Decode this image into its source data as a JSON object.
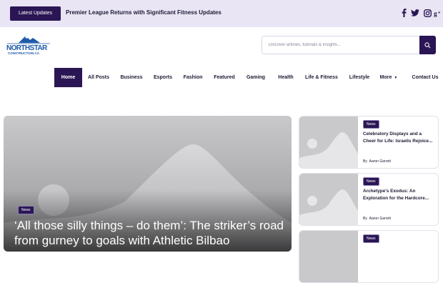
{
  "topbar": {
    "latest_label": "Latest Updates",
    "ticker_text": "Premier League Returns with Significant Fitness Updates",
    "social": [
      "facebook-icon",
      "twitter-icon",
      "instagram-icon",
      "google-plus-icon"
    ]
  },
  "logo": {
    "line1": "NORTHSTAR",
    "line2": "CONSTRUCTION.CA"
  },
  "search": {
    "placeholder": "Discover articles, tutorials & insights..."
  },
  "nav": {
    "items": [
      "Home",
      "All Posts",
      "Business",
      "Esports",
      "Fashion",
      "Featured",
      "Gaming",
      "Health",
      "Life & Fitness",
      "Lifestyle",
      "More",
      "Contact Us"
    ],
    "active": "Home"
  },
  "hero": {
    "badge": "News",
    "title": "‘All those silly things – do them’: The striker’s road from gurney to goals with Athletic Bilbao"
  },
  "cards": [
    {
      "badge": "News",
      "title": "Celebratory Displays and a Cheer for Life: Israelis Rejoice...",
      "author_prefix": "By",
      "author": "Aaron Garrett"
    },
    {
      "badge": "News",
      "title": "Archetype's Exodus: An Exploration for the Hardcore...",
      "author_prefix": "By",
      "author": "Aaron Garrett"
    },
    {
      "badge": "News",
      "title": "",
      "author_prefix": "",
      "author": ""
    }
  ],
  "colors": {
    "accent": "#2a1654",
    "topbar": "#e9e5f4",
    "placeholder_bg": "#c9c9cc"
  }
}
